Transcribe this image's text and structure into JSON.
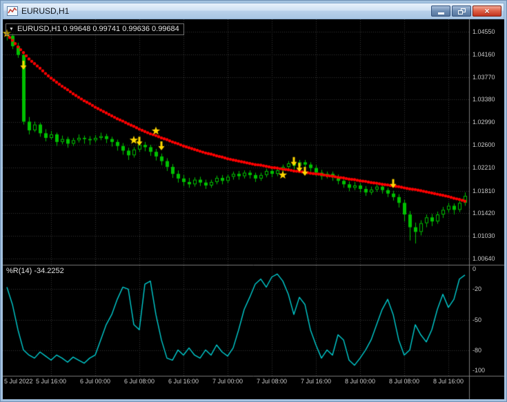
{
  "window": {
    "title": "EURUSD,H1",
    "close_glyph": "×"
  },
  "chart": {
    "symbol_dropdown_glyph": "▼",
    "symbol_label": "EURUSD,H1 0.99648 0.99741 0.99636 0.99684",
    "indicator_label": "%R(14) -34.2252",
    "price_axis_labels": [
      "1.04550",
      "1.04160",
      "1.03770",
      "1.03380",
      "1.02990",
      "1.02600",
      "1.02210",
      "1.01810",
      "1.01420",
      "1.01030",
      "1.00640"
    ],
    "indicator_axis_labels": [
      "0",
      "-20",
      "-50",
      "-80",
      "-100"
    ],
    "time_axis_labels": [
      "5 Jul 2022",
      "5 Jul 16:00",
      "6 Jul 00:00",
      "6 Jul 08:00",
      "6 Jul 16:00",
      "7 Jul 00:00",
      "7 Jul 08:00",
      "7 Jul 16:00",
      "8 Jul 00:00",
      "8 Jul 08:00",
      "8 Jul 16:00"
    ],
    "colors": {
      "background": "#000000",
      "grid": "#373737",
      "separator": "#7A7A7A",
      "candle": "#00C000",
      "bull_fill": "#000000",
      "trend_dots": "#FF0000",
      "williams_r_line": "#00CED1",
      "marker": "#FFD700",
      "axis_text": "#C8C8C8"
    }
  },
  "chart_data": {
    "type": "candlestick",
    "symbol": "EURUSD",
    "timeframe": "H1",
    "price_range": [
      1.0064,
      1.0455
    ],
    "indicator": {
      "name": "Williams %R",
      "period": 14,
      "current": -34.2252,
      "range": [
        -100,
        0
      ]
    },
    "candles": [
      [
        1.0452,
        1.0455,
        1.044,
        1.0448
      ],
      [
        1.0448,
        1.0452,
        1.0425,
        1.043
      ],
      [
        1.043,
        1.0436,
        1.041,
        1.0415
      ],
      [
        1.0415,
        1.0418,
        1.0295,
        1.03
      ],
      [
        1.03,
        1.0308,
        1.0278,
        1.0285
      ],
      [
        1.0285,
        1.03,
        1.0282,
        1.0295
      ],
      [
        1.0295,
        1.0298,
        1.0274,
        1.028
      ],
      [
        1.028,
        1.0287,
        1.0266,
        1.0272
      ],
      [
        1.0272,
        1.0284,
        1.0269,
        1.0278
      ],
      [
        1.0278,
        1.0281,
        1.0258,
        1.0265
      ],
      [
        1.0265,
        1.0276,
        1.0261,
        1.027
      ],
      [
        1.027,
        1.0274,
        1.0255,
        1.0262
      ],
      [
        1.0262,
        1.0272,
        1.0258,
        1.0268
      ],
      [
        1.0268,
        1.0278,
        1.0264,
        1.0272
      ],
      [
        1.0272,
        1.0276,
        1.0262,
        1.027
      ],
      [
        1.027,
        1.0275,
        1.026,
        1.0268
      ],
      [
        1.0268,
        1.0277,
        1.0264,
        1.0272
      ],
      [
        1.0272,
        1.0281,
        1.0268,
        1.0275
      ],
      [
        1.0275,
        1.0279,
        1.0263,
        1.027
      ],
      [
        1.027,
        1.0274,
        1.0257,
        1.0265
      ],
      [
        1.0265,
        1.0269,
        1.025,
        1.0258
      ],
      [
        1.0258,
        1.0263,
        1.0243,
        1.025
      ],
      [
        1.025,
        1.0255,
        1.0234,
        1.0242
      ],
      [
        1.0242,
        1.0256,
        1.0238,
        1.0252
      ],
      [
        1.0252,
        1.0264,
        1.0248,
        1.026
      ],
      [
        1.026,
        1.0265,
        1.0249,
        1.0256
      ],
      [
        1.0256,
        1.026,
        1.0241,
        1.0248
      ],
      [
        1.0248,
        1.0253,
        1.0233,
        1.024
      ],
      [
        1.024,
        1.0245,
        1.0225,
        1.0232
      ],
      [
        1.0232,
        1.0237,
        1.0215,
        1.0222
      ],
      [
        1.0222,
        1.0227,
        1.0203,
        1.021
      ],
      [
        1.021,
        1.0216,
        1.0195,
        1.0202
      ],
      [
        1.0202,
        1.0208,
        1.0189,
        1.0196
      ],
      [
        1.0196,
        1.0203,
        1.0186,
        1.0192
      ],
      [
        1.0192,
        1.0204,
        1.0188,
        1.02
      ],
      [
        1.02,
        1.0205,
        1.0189,
        1.0195
      ],
      [
        1.0195,
        1.02,
        1.0184,
        1.019
      ],
      [
        1.019,
        1.02,
        1.0186,
        1.0196
      ],
      [
        1.0196,
        1.0207,
        1.0192,
        1.0203
      ],
      [
        1.0203,
        1.0208,
        1.0192,
        1.0198
      ],
      [
        1.0198,
        1.0209,
        1.0194,
        1.0205
      ],
      [
        1.0205,
        1.0214,
        1.02,
        1.021
      ],
      [
        1.021,
        1.0215,
        1.02,
        1.0206
      ],
      [
        1.0206,
        1.0216,
        1.0202,
        1.0212
      ],
      [
        1.0212,
        1.0216,
        1.0202,
        1.0208
      ],
      [
        1.0208,
        1.0212,
        1.0196,
        1.0202
      ],
      [
        1.0202,
        1.0212,
        1.0198,
        1.0208
      ],
      [
        1.0208,
        1.0219,
        1.0204,
        1.0215
      ],
      [
        1.0215,
        1.0219,
        1.0204,
        1.021
      ],
      [
        1.021,
        1.022,
        1.0206,
        1.0216
      ],
      [
        1.0216,
        1.0226,
        1.0212,
        1.0222
      ],
      [
        1.0222,
        1.0232,
        1.0218,
        1.0228
      ],
      [
        1.0228,
        1.0232,
        1.0218,
        1.0224
      ],
      [
        1.0224,
        1.0234,
        1.022,
        1.023
      ],
      [
        1.023,
        1.0234,
        1.022,
        1.0226
      ],
      [
        1.0226,
        1.023,
        1.0214,
        1.022
      ],
      [
        1.022,
        1.0225,
        1.0206,
        1.0212
      ],
      [
        1.0212,
        1.0217,
        1.02,
        1.0206
      ],
      [
        1.0206,
        1.0214,
        1.0202,
        1.021
      ],
      [
        1.021,
        1.0214,
        1.0198,
        1.0204
      ],
      [
        1.0204,
        1.0209,
        1.0192,
        1.0198
      ],
      [
        1.0198,
        1.0203,
        1.0186,
        1.0192
      ],
      [
        1.0192,
        1.0197,
        1.018,
        1.0186
      ],
      [
        1.0186,
        1.0196,
        1.0182,
        1.019
      ],
      [
        1.019,
        1.0194,
        1.0178,
        1.0184
      ],
      [
        1.0184,
        1.0189,
        1.0172,
        1.0178
      ],
      [
        1.0178,
        1.0188,
        1.0174,
        1.0183
      ],
      [
        1.0183,
        1.0193,
        1.0179,
        1.0188
      ],
      [
        1.0188,
        1.0192,
        1.0176,
        1.0182
      ],
      [
        1.0182,
        1.0186,
        1.017,
        1.0176
      ],
      [
        1.0176,
        1.0181,
        1.0164,
        1.017
      ],
      [
        1.017,
        1.0175,
        1.0152,
        1.016
      ],
      [
        1.016,
        1.0165,
        1.0128,
        1.014
      ],
      [
        1.014,
        1.0146,
        1.0095,
        1.0118
      ],
      [
        1.0118,
        1.0126,
        1.009,
        1.011
      ],
      [
        1.011,
        1.013,
        1.0104,
        1.0125
      ],
      [
        1.0125,
        1.014,
        1.0118,
        1.0135
      ],
      [
        1.0135,
        1.0141,
        1.012,
        1.0128
      ],
      [
        1.0128,
        1.0145,
        1.0124,
        1.014
      ],
      [
        1.014,
        1.0153,
        1.0134,
        1.0148
      ],
      [
        1.0148,
        1.016,
        1.0143,
        1.0155
      ],
      [
        1.0155,
        1.0159,
        1.014,
        1.0148
      ],
      [
        1.0148,
        1.0165,
        1.0144,
        1.016
      ],
      [
        1.016,
        1.0178,
        1.0155,
        1.0172
      ]
    ],
    "trend_dots": [
      1.045,
      1.044,
      1.0429,
      1.0419,
      1.0408,
      1.04,
      1.0392,
      1.0383,
      1.0375,
      1.0368,
      1.0361,
      1.0355,
      1.0348,
      1.0342,
      1.0336,
      1.0331,
      1.0325,
      1.032,
      1.0315,
      1.031,
      1.0305,
      1.0301,
      1.0296,
      1.0292,
      1.0287,
      1.0283,
      1.0279,
      1.0276,
      1.0272,
      1.0269,
      1.0265,
      1.0262,
      1.0258,
      1.0255,
      1.0252,
      1.0249,
      1.0246,
      1.0244,
      1.0241,
      1.0239,
      1.0236,
      1.0234,
      1.0232,
      1.023,
      1.0228,
      1.0226,
      1.0225,
      1.0223,
      1.0221,
      1.022,
      1.0218,
      1.0217,
      1.0215,
      1.0214,
      1.0213,
      1.0211,
      1.021,
      1.0209,
      1.0207,
      1.0206,
      1.0204,
      1.0203,
      1.0201,
      1.02,
      1.0198,
      1.0197,
      1.0195,
      1.0194,
      1.0192,
      1.0191,
      1.0189,
      1.0188,
      1.0186,
      1.0184,
      1.0183,
      1.0181,
      1.0179,
      1.0177,
      1.0175,
      1.0173,
      1.0171,
      1.0168,
      1.0166,
      1.0163
    ],
    "williams_r": [
      -18,
      -35,
      -60,
      -80,
      -85,
      -88,
      -82,
      -86,
      -90,
      -85,
      -88,
      -92,
      -87,
      -90,
      -93,
      -88,
      -85,
      -70,
      -55,
      -45,
      -30,
      -18,
      -20,
      -55,
      -60,
      -15,
      -12,
      -45,
      -70,
      -88,
      -90,
      -80,
      -85,
      -78,
      -85,
      -88,
      -80,
      -85,
      -75,
      -82,
      -86,
      -78,
      -60,
      -40,
      -28,
      -15,
      -10,
      -18,
      -8,
      -5,
      -12,
      -25,
      -45,
      -28,
      -35,
      -60,
      -75,
      -88,
      -80,
      -85,
      -65,
      -70,
      -90,
      -95,
      -88,
      -80,
      -70,
      -55,
      -40,
      -30,
      -45,
      -70,
      -85,
      -80,
      -55,
      -65,
      -72,
      -60,
      -40,
      -25,
      -38,
      -30,
      -10,
      -6
    ],
    "markers": {
      "stars": [
        {
          "bar": 0,
          "price": 1.0452
        },
        {
          "bar": 23,
          "price": 1.0268
        },
        {
          "bar": 27,
          "price": 1.0284
        },
        {
          "bar": 50,
          "price": 1.0208
        }
      ],
      "down_arrows": [
        {
          "bar": 3,
          "price": 1.0405
        },
        {
          "bar": 24,
          "price": 1.0274
        },
        {
          "bar": 28,
          "price": 1.0266
        },
        {
          "bar": 52,
          "price": 1.0239
        },
        {
          "bar": 53,
          "price": 1.0229
        },
        {
          "bar": 54,
          "price": 1.0222
        },
        {
          "bar": 70,
          "price": 1.0201
        }
      ]
    }
  }
}
